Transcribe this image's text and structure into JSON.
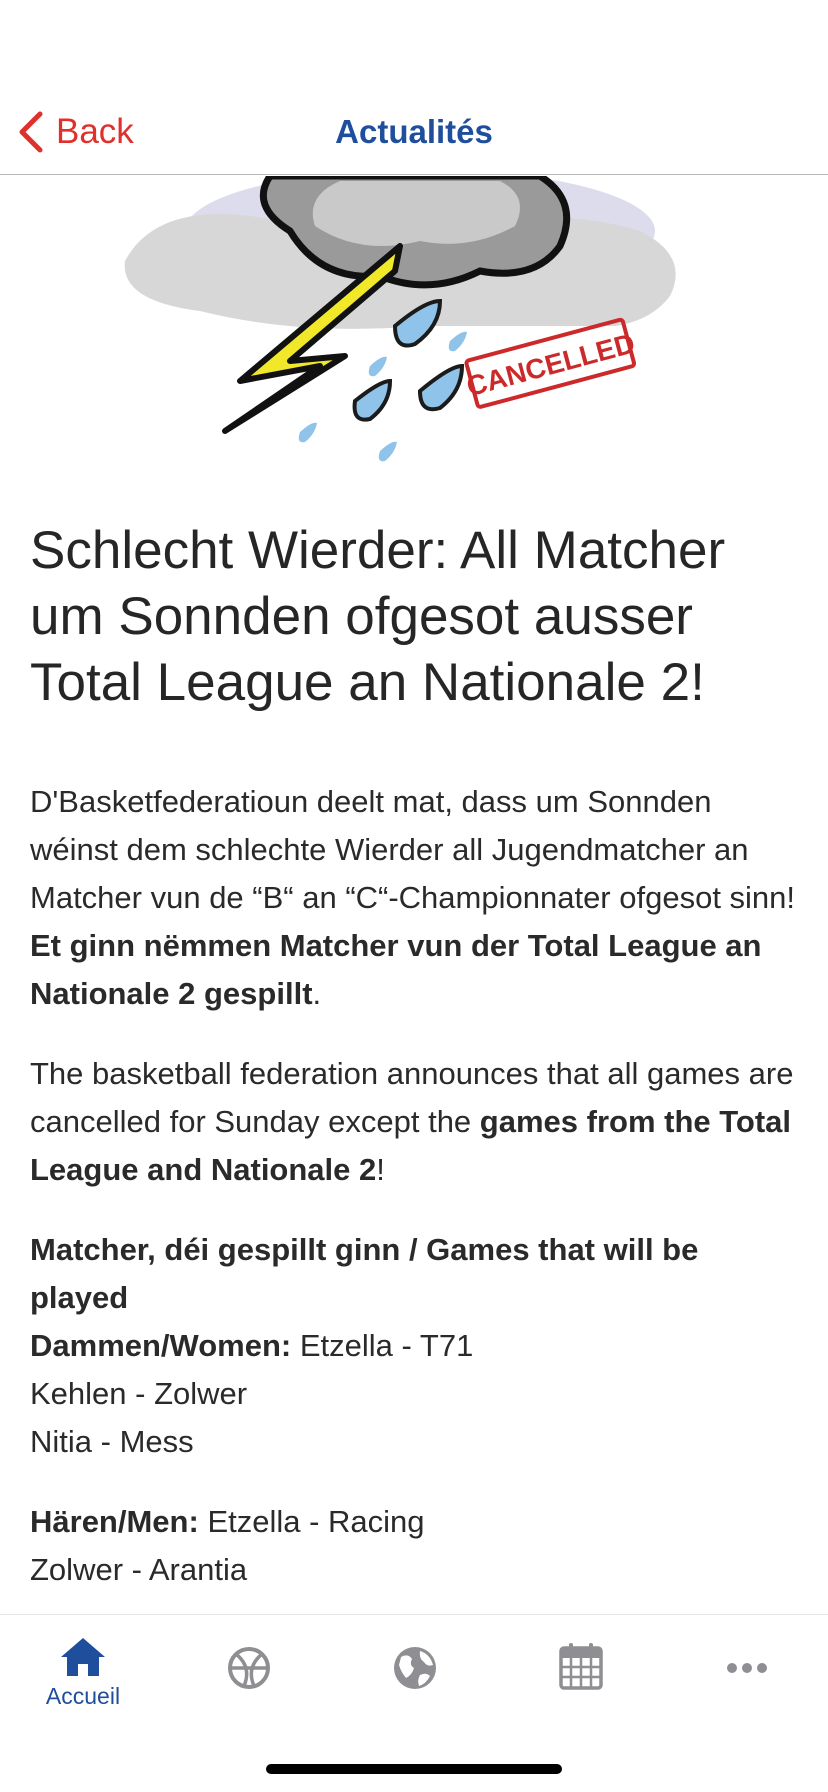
{
  "header": {
    "back_label": "Back",
    "title": "Actualités"
  },
  "hero": {
    "stamp_text": "CANCELLED",
    "icon": "storm-cloud-cancelled-image"
  },
  "article": {
    "headline": "Schlecht Wierder: All Matcher um Sonnden ofgesot ausser Total League an Nationale 2!",
    "p1_text": "D'Basketfederatioun deelt mat, dass um Sonnden wéinst dem schlechte Wierder all Jugendmatcher an Matcher vun de “B“ an “C“-Championnater ofgesot sinn! ",
    "p1_bold": "Et ginn nëmmen Matcher vun der Total League an Nationale 2 gespillt",
    "p1_end": ".",
    "p2_text": "The basketball federation announces that all games are cancelled for Sunday except the ",
    "p2_bold": "games from the Total League and Nationale 2",
    "p2_end": "!",
    "games_heading": "Matcher, déi gespillt ginn / Games that will be played",
    "women_label": "Dammen/Women:",
    "women_games": [
      "Etzella - T71",
      "Kehlen - Zolwer",
      "Nitia - Mess"
    ],
    "men_label": "Hären/Men:",
    "men_games": [
      "Etzella - Racing",
      "Zolwer - Arantia"
    ]
  },
  "tabbar": {
    "tabs": [
      {
        "label": "Accueil",
        "icon": "home-icon",
        "active": true
      },
      {
        "label": "",
        "icon": "basketball-icon",
        "active": false
      },
      {
        "label": "",
        "icon": "globe-icon",
        "active": false
      },
      {
        "label": "",
        "icon": "calendar-icon",
        "active": false
      },
      {
        "label": "",
        "icon": "more-icon",
        "active": false
      }
    ]
  },
  "colors": {
    "accent": "#1f4e9c",
    "back": "#e0302c",
    "inactive_icon": "#8e8e93",
    "stamp": "#cc2a2a"
  }
}
